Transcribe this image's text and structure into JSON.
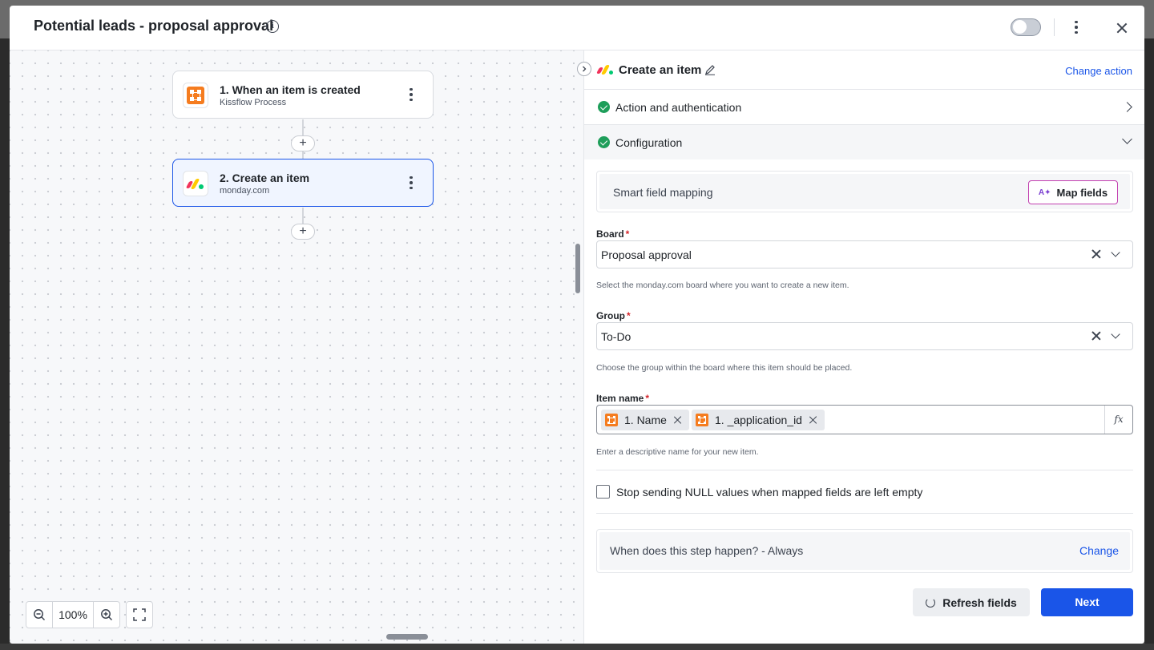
{
  "modal": {
    "title": "Potential leads - proposal approval",
    "info_icon": "info-icon",
    "toggle_enabled": false
  },
  "canvas": {
    "nodes": [
      {
        "title": "1. When an item is created",
        "subtitle": "Kissflow Process",
        "icon": "kissflow-logo"
      },
      {
        "title": "2. Create an item",
        "subtitle": "monday.com",
        "icon": "monday-logo",
        "selected": true
      }
    ],
    "zoom": {
      "value": "100%"
    }
  },
  "panel": {
    "title": "Create an item",
    "change_action": "Change action",
    "sections": {
      "auth": "Action and authentication",
      "config": "Configuration"
    },
    "smart_mapping": {
      "label": "Smart field mapping",
      "button": "Map fields"
    },
    "board": {
      "label": "Board",
      "value": "Proposal approval",
      "help": "Select the monday.com board where you want to create a new item."
    },
    "group": {
      "label": "Group",
      "value": "To-Do",
      "help": "Choose the group within the board where this item should be placed."
    },
    "item_name": {
      "label": "Item name",
      "tags": [
        "1. Name",
        "1. _application_id"
      ],
      "fx": "fx",
      "help": "Enter a descriptive name for your new item."
    },
    "null_option": {
      "label": "Stop sending NULL values when mapped fields are left empty",
      "checked": false
    },
    "when": {
      "label": "When does this step happen? - Always",
      "change": "Change"
    },
    "buttons": {
      "refresh": "Refresh fields",
      "next": "Next"
    }
  },
  "colors": {
    "accent": "#1a55e8",
    "success": "#1e9e5a",
    "kissflow": "#f57c1f",
    "required": "#d4252b"
  }
}
